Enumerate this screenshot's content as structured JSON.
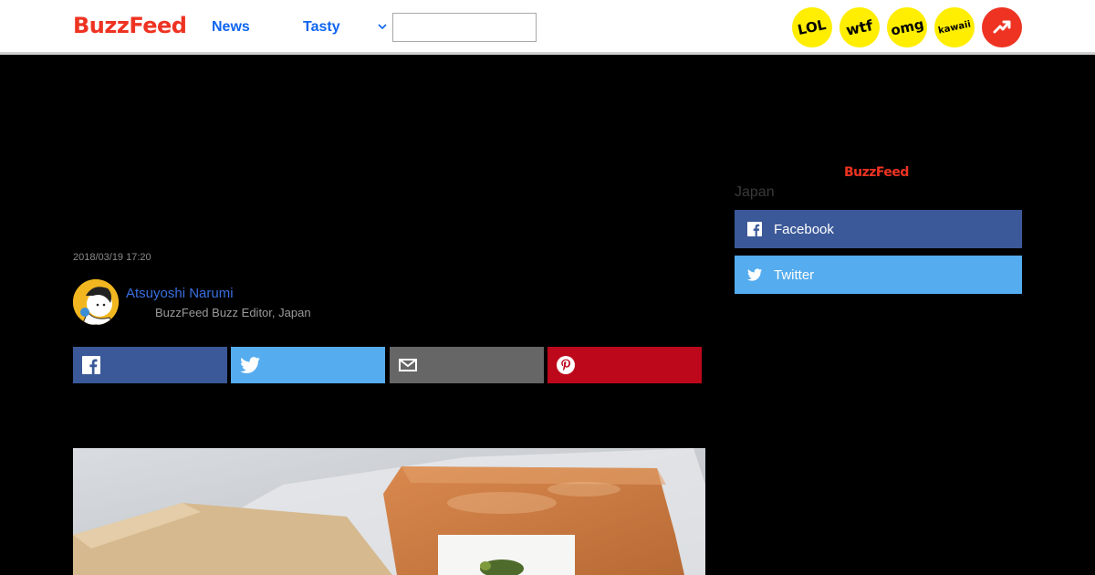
{
  "header": {
    "logo": "BuzzFeed",
    "nav": {
      "news": "News",
      "tasty": "Tasty"
    },
    "search": {
      "value": "",
      "placeholder": ""
    },
    "badges": {
      "lol": "LOL",
      "wtf": "wtf",
      "omg": "omg",
      "kawaii": "kawaii"
    }
  },
  "article": {
    "timestamp": "2018/03/19 17:20",
    "author": {
      "name": "Atsuyoshi Narumi",
      "title": "BuzzFeed Buzz Editor, Japan"
    }
  },
  "sidebar": {
    "logo": "BuzzFeed",
    "region": "Japan",
    "follow": {
      "facebook": "Facebook",
      "twitter": "Twitter"
    }
  },
  "colors": {
    "brand_red": "#ee3322",
    "link_blue": "#0f65ef",
    "facebook": "#3b5998",
    "twitter": "#55acee",
    "email": "#666666",
    "pinterest": "#bd081c",
    "badge_yellow": "#ffee00"
  },
  "icons": [
    "chevron-down-icon",
    "trending-arrow-icon",
    "facebook-icon",
    "twitter-icon",
    "email-icon",
    "pinterest-icon"
  ]
}
